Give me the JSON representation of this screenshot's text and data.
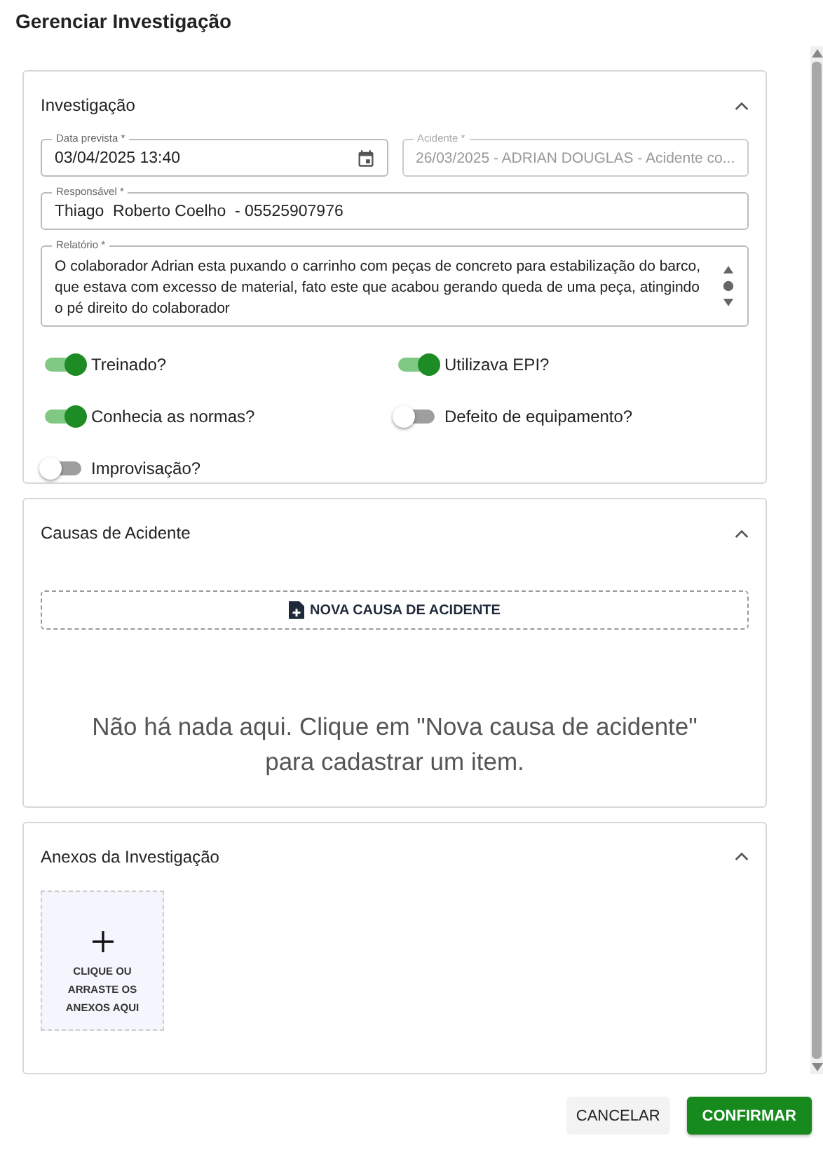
{
  "title": "Gerenciar Investigação",
  "investigation": {
    "heading": "Investigação",
    "expanded": true,
    "fields": [
      {
        "kind": "date",
        "label": "Data prevista *",
        "value": "03/04/2025 13:40",
        "disabled": false
      },
      {
        "kind": "text",
        "label": "Acidente *",
        "value": "26/03/2025 - ADRIAN DOUGLAS - Acidente co...",
        "disabled": true
      },
      {
        "kind": "text",
        "label": "Responsável *",
        "value": "Thiago  Roberto Coelho  - 05525907976",
        "disabled": false
      },
      {
        "kind": "textarea",
        "label": "Relatório *",
        "value": "O colaborador Adrian esta puxando o carrinho com peças de concreto para estabilização do barco, que estava com excesso de material, fato este que acabou gerando queda de uma peça, atingindo o pé direito do colaborador",
        "disabled": false
      }
    ],
    "toggles": [
      {
        "label": "Treinado?",
        "on": true
      },
      {
        "label": "Utilizava EPI?",
        "on": true
      },
      {
        "label": "Conhecia as normas?",
        "on": true
      },
      {
        "label": "Defeito de equipamento?",
        "on": false
      },
      {
        "label": "Improvisação?",
        "on": false
      }
    ]
  },
  "causes": {
    "heading": "Causas de Acidente",
    "expanded": true,
    "add_button": "NOVA CAUSA DE ACIDENTE",
    "empty_message": "Não há nada aqui. Clique em \"Nova causa de acidente\" para cadastrar um item."
  },
  "attachments": {
    "heading": "Anexos da Investigação",
    "expanded": true,
    "dropzone": "CLIQUE OU ARRASTE OS ANEXOS AQUI"
  },
  "buttons": [
    {
      "label": "CANCELAR",
      "kind": "text"
    },
    {
      "label": "CONFIRMAR",
      "kind": "primary"
    }
  ]
}
